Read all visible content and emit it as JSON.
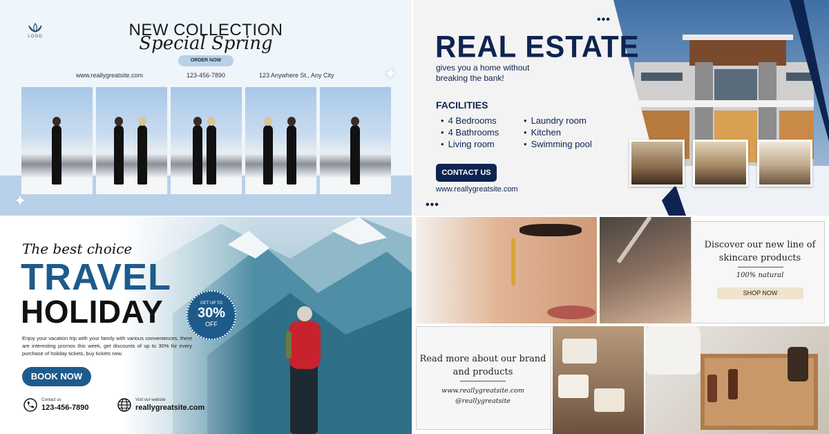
{
  "collection": {
    "logo_text": "LOGO",
    "title_line1": "NEW COLLECTION",
    "title_line2": "Special Spring",
    "order_button": "ORDER NOW",
    "website": "www.reallygreatsite.com",
    "phone": "123-456-7890",
    "address": "123 Anywhere St., Any City",
    "colors": {
      "background": "#eef5fb",
      "band": "#b9d1e8"
    }
  },
  "real_estate": {
    "title": "REAL ESTATE",
    "subtitle": "gives you a home without breaking the bank!",
    "facilities_heading": "FACILITIES",
    "facilities_left": [
      "4 Bedrooms",
      "4 Bathrooms",
      "Living room"
    ],
    "facilities_right": [
      "Laundry room",
      "Kitchen",
      "Swimming pool"
    ],
    "contact_button": "CONTACT US",
    "website": "www.reallygreatsite.com",
    "dots": "•••",
    "colors": {
      "navy": "#0d2451"
    }
  },
  "travel": {
    "tagline": "The best choice",
    "title_line1": "TRAVEL",
    "title_line2": "HOLIDAY",
    "description": "Enjoy your vacation trip with your family with various conveniences, there are interesting promos this week, get discounts of up to 30% for every purchase of holiday tickets, buy tickets now.",
    "book_button": "BOOK NOW",
    "badge_top": "GET UP TO",
    "badge_value": "30%",
    "badge_bottom": "OFF",
    "contact_caption": "Contact us",
    "contact_phone": "123-456-7890",
    "website_caption": "Visit our website",
    "website": "reallygreatsite.com",
    "colors": {
      "blue": "#1d5b8c"
    }
  },
  "skincare": {
    "discover_text": "Discover our new line of skincare products",
    "natural_text": "100% natural",
    "shop_button": "SHOP NOW",
    "read_more_text": "Read more about our brand and products",
    "website": "www.reallygreatsite.com",
    "handle": "@reallygreatsite",
    "colors": {
      "shop_bg": "#efe3cd"
    }
  }
}
